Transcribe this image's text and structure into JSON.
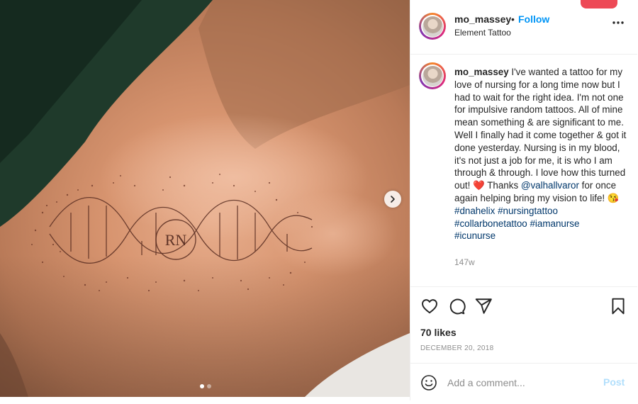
{
  "header": {
    "username": "mo_massey",
    "separator": "•",
    "follow_label": "Follow",
    "location": "Element Tattoo",
    "more_icon": "more-horizontal-icon"
  },
  "caption": {
    "username": "mo_massey",
    "text_1": " I've wanted a tattoo for my love of nursing for a long time now but I had to wait for the right idea. I'm not one for impulsive random tattoos. All of mine mean something & are significant to me. Well I finally had it come together & got it done yesterday. Nursing is in my blood, it's not just a job for me, it is who I am through & through. I love how this turned out! ",
    "heart_emoji": "❤️",
    "text_2": " Thanks ",
    "mention": "@valhallvaror",
    "text_3": " for once again helping bring my vision to life! ",
    "kiss_emoji": "😘",
    "hashtags": [
      "#dnahelix",
      "#nursingtattoo",
      "#collarbonetattoo",
      "#iamanurse",
      "#icunurse"
    ],
    "time_ago": "147w"
  },
  "media": {
    "tattoo_text": "RN",
    "carousel_total": 2,
    "carousel_active": 1
  },
  "actions": {
    "icons": [
      "heart-icon",
      "comment-icon",
      "share-icon",
      "bookmark-icon"
    ],
    "likes": "70 likes",
    "date": "DECEMBER 20, 2018"
  },
  "comment": {
    "placeholder": "Add a comment...",
    "post_label": "Post"
  },
  "colors": {
    "accent": "#0095f6",
    "post_disabled": "#b2dffc",
    "link": "#00376b",
    "muted": "#8e8e8e"
  }
}
